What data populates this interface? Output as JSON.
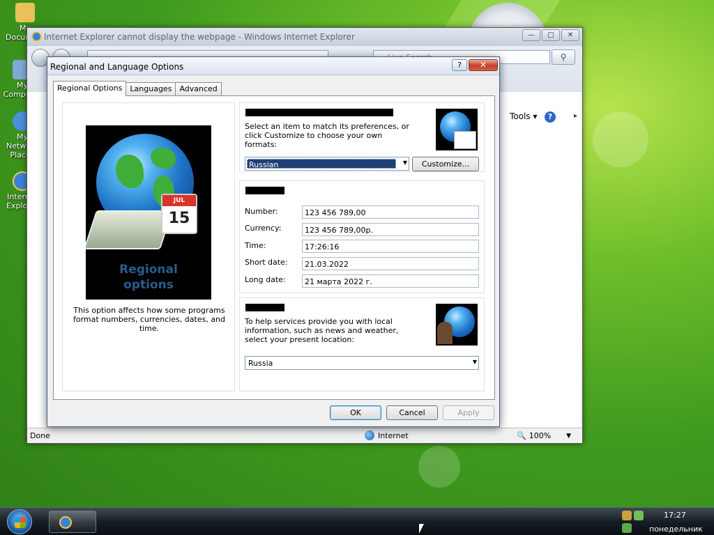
{
  "desktop": {
    "icons": [
      {
        "label": "My Documents"
      },
      {
        "label": "My Computer"
      },
      {
        "label": "My Network Places"
      },
      {
        "label": "Internet Explorer"
      }
    ]
  },
  "ie": {
    "title": "Internet Explorer cannot display the webpage - Windows Internet Explorer",
    "search_placeholder": "Live Search",
    "tools_label": "Tools",
    "status": {
      "done": "Done",
      "zone": "Internet",
      "zoom": "100%"
    }
  },
  "dialog": {
    "title": "Regional and Language Options",
    "tabs": [
      {
        "label": "Regional Options",
        "active": true
      },
      {
        "label": "Languages",
        "active": false
      },
      {
        "label": "Advanced",
        "active": false
      }
    ],
    "illustration_caption_line1": "Regional",
    "illustration_caption_line2": "options",
    "calendar_month": "JUL",
    "calendar_day": "15",
    "left_description": "This option affects how some programs format numbers, currencies, dates, and time.",
    "formats": {
      "description": "Select an item to match its preferences, or click Customize to choose your own formats:",
      "selected": "Russian",
      "customize_label": "Customize..."
    },
    "samples": {
      "rows": [
        {
          "label": "Number:",
          "value": "123 456 789,00"
        },
        {
          "label": "Currency:",
          "value": "123 456 789,00р."
        },
        {
          "label": "Time:",
          "value": "17:26:16"
        },
        {
          "label": "Short date:",
          "value": "21.03.2022"
        },
        {
          "label": "Long date:",
          "value": "21 марта 2022 г."
        }
      ]
    },
    "location": {
      "description": "To help services provide you with local information, such as news and weather, select your present location:",
      "selected": "Russia"
    },
    "buttons": {
      "ok": "OK",
      "cancel": "Cancel",
      "apply": "Apply"
    }
  },
  "taskbar": {
    "time": "17:27",
    "day": "понедельник"
  },
  "colors": {
    "selection": "#1f3f74",
    "close_button": "#c4402b",
    "desktop_green": "#3f9a1e"
  }
}
